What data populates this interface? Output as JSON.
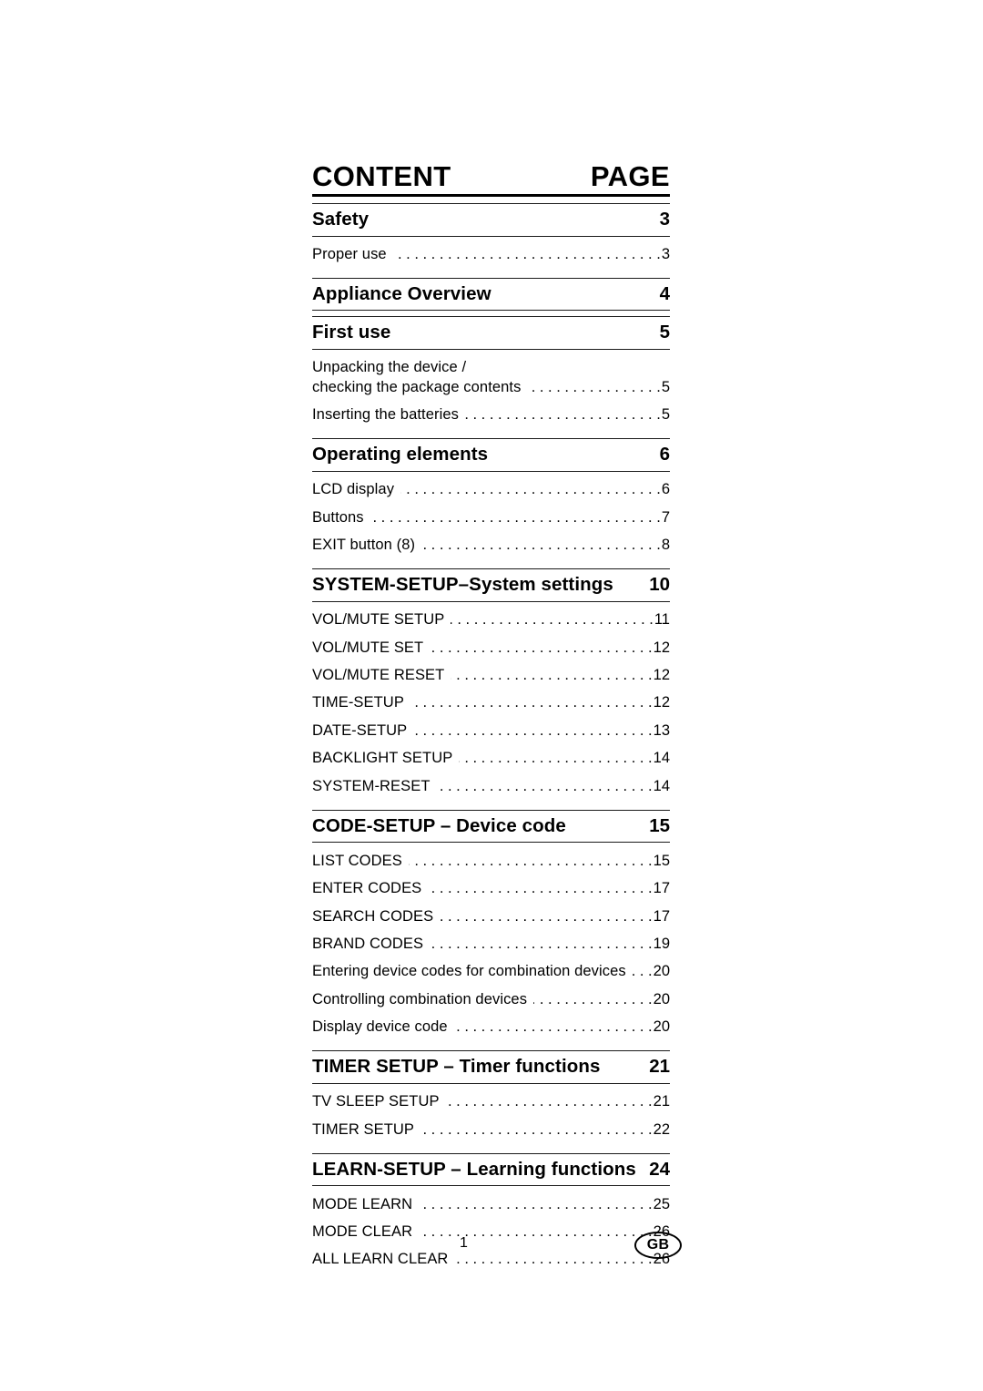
{
  "document": {
    "heading_left": "CONTENT",
    "heading_right": "PAGE",
    "footer_page_number": "1",
    "footer_badge": "GB"
  },
  "toc": {
    "sections": [
      {
        "title": "Safety",
        "page": "3",
        "entries": [
          {
            "label": "Proper use",
            "page": "3"
          }
        ]
      },
      {
        "title": "Appliance Overview",
        "page": "4",
        "entries": []
      },
      {
        "title": "First use",
        "page": "5",
        "entries": [
          {
            "label": "Unpacking the device /",
            "label2": "checking the package contents",
            "page": "5"
          },
          {
            "label": "Inserting the batteries",
            "page": "5"
          }
        ]
      },
      {
        "title": "Operating elements",
        "page": "6",
        "entries": [
          {
            "label": "LCD display",
            "page": "6"
          },
          {
            "label": "Buttons",
            "page": "7"
          },
          {
            "label": "EXIT button (8)",
            "page": "8"
          }
        ]
      },
      {
        "title": "SYSTEM-SETUP–System settings",
        "page": "10",
        "entries": [
          {
            "label": "VOL/MUTE SETUP",
            "page": "11"
          },
          {
            "label": "VOL/MUTE SET",
            "page": "12"
          },
          {
            "label": "VOL/MUTE RESET",
            "page": "12"
          },
          {
            "label": "TIME-SETUP",
            "page": "12"
          },
          {
            "label": "DATE-SETUP",
            "page": "13"
          },
          {
            "label": "BACKLIGHT SETUP",
            "page": "14"
          },
          {
            "label": "SYSTEM-RESET",
            "page": "14"
          }
        ]
      },
      {
        "title": "CODE-SETUP – Device code",
        "page": "15",
        "entries": [
          {
            "label": "LIST CODES",
            "page": "15"
          },
          {
            "label": "ENTER CODES",
            "page": "17"
          },
          {
            "label": "SEARCH CODES",
            "page": "17"
          },
          {
            "label": "BRAND CODES",
            "page": "19"
          },
          {
            "label": "Entering device codes for combination devices",
            "page": "20"
          },
          {
            "label": "Controlling combination devices",
            "page": "20"
          },
          {
            "label": "Display device code",
            "page": "20"
          }
        ]
      },
      {
        "title": "TIMER SETUP – Timer functions",
        "page": "21",
        "entries": [
          {
            "label": "TV SLEEP SETUP",
            "page": "21"
          },
          {
            "label": "TIMER SETUP",
            "page": "22"
          }
        ]
      },
      {
        "title": "LEARN-SETUP – Learning functions",
        "page": "24",
        "entries": [
          {
            "label": "MODE LEARN",
            "page": "25"
          },
          {
            "label": "MODE CLEAR",
            "page": "26"
          },
          {
            "label": "ALL LEARN CLEAR",
            "page": "26"
          }
        ]
      }
    ]
  }
}
